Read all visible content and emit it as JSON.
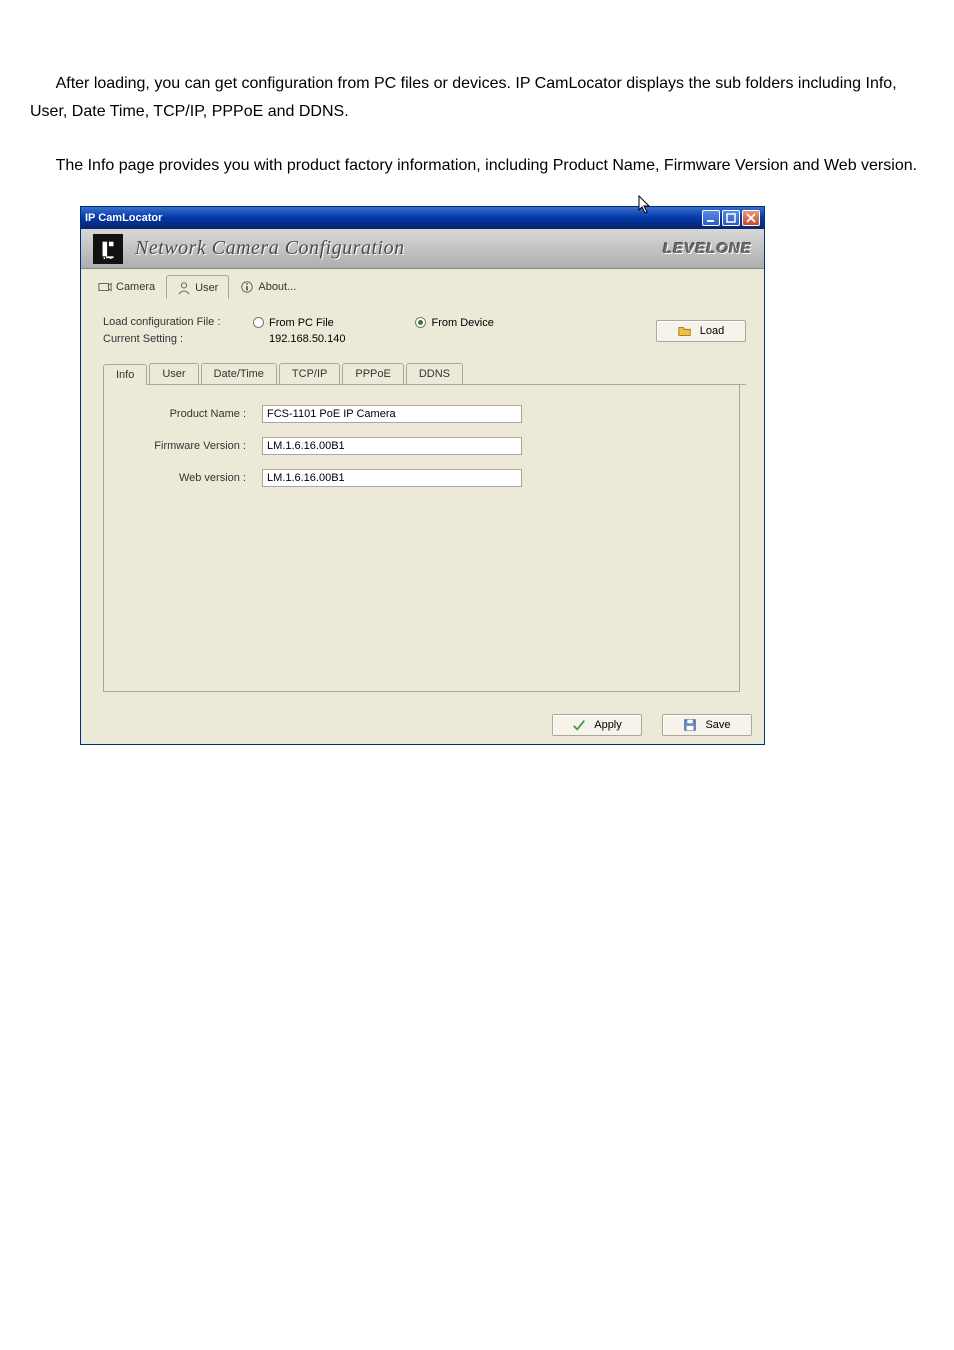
{
  "paragraphs": {
    "p1": "After loading, you can get configuration from PC files or devices. IP CamLocator displays the sub folders including Info, User, Date Time, TCP/IP, PPPoE and DDNS.",
    "p2": "The Info page provides you with product factory information, including Product Name, Firmware Version and Web version."
  },
  "window": {
    "title": "IP CamLocator",
    "band_title": "Network Camera Configuration",
    "brand": "LEVELONE",
    "outer_tabs": {
      "camera": "Camera",
      "user": "User",
      "about": "About..."
    },
    "load_row": {
      "label_line1": "Load configuration File :",
      "label_line2": "Current Setting :",
      "from_pc": "From PC File",
      "from_device": "From Device",
      "current_ip": "192.168.50.140",
      "load_btn": "Load"
    },
    "inner_tabs": {
      "info": "Info",
      "user": "User",
      "datetime": "Date/Time",
      "tcpip": "TCP/IP",
      "pppoe": "PPPoE",
      "ddns": "DDNS"
    },
    "info": {
      "product_name_label": "Product Name :",
      "product_name_value": "FCS-1101 PoE IP Camera",
      "firmware_label": "Firmware Version :",
      "firmware_value": "LM.1.6.16.00B1",
      "web_label": "Web version :",
      "web_value": "LM.1.6.16.00B1"
    },
    "footer": {
      "apply": "Apply",
      "save": "Save"
    }
  }
}
